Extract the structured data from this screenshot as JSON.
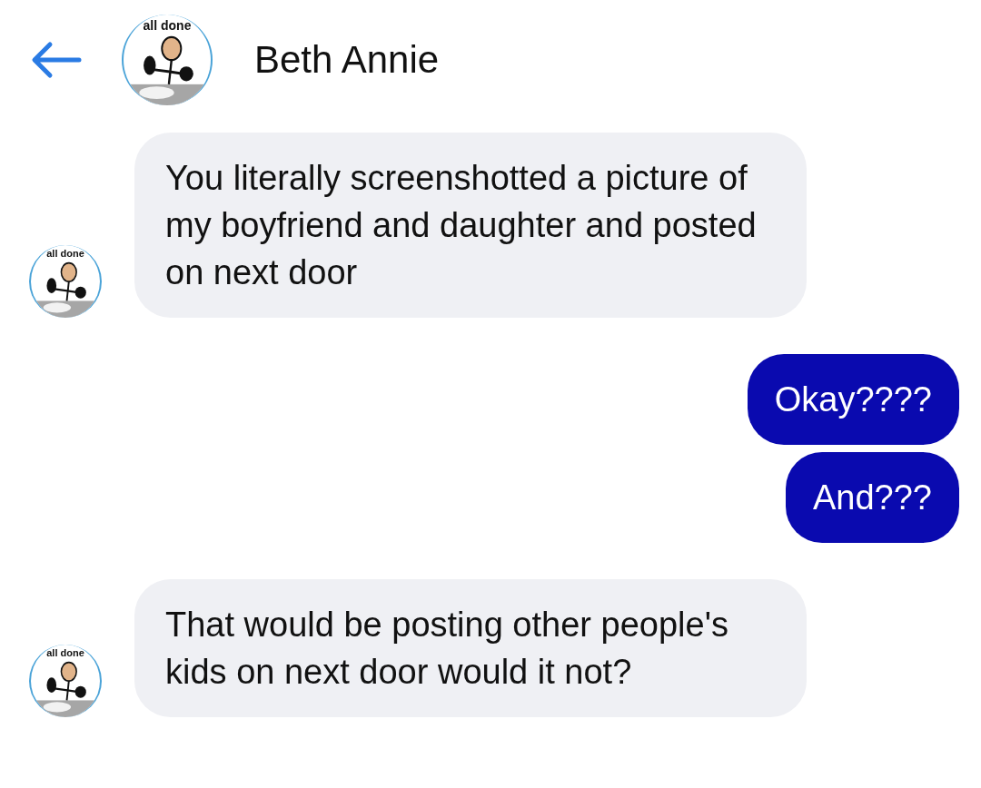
{
  "header": {
    "title": "Beth Annie",
    "avatar_label": "all done"
  },
  "messages": [
    {
      "kind": "incoming",
      "text": "You literally screenshotted a picture of my boyfriend and daughter and posted on next door",
      "avatar_label": "all done"
    },
    {
      "kind": "outgoing",
      "text": "Okay????"
    },
    {
      "kind": "outgoing",
      "text": "And???"
    },
    {
      "kind": "incoming",
      "text": "That would be posting other people's kids on next door would it not?",
      "avatar_label": "all done"
    }
  ]
}
